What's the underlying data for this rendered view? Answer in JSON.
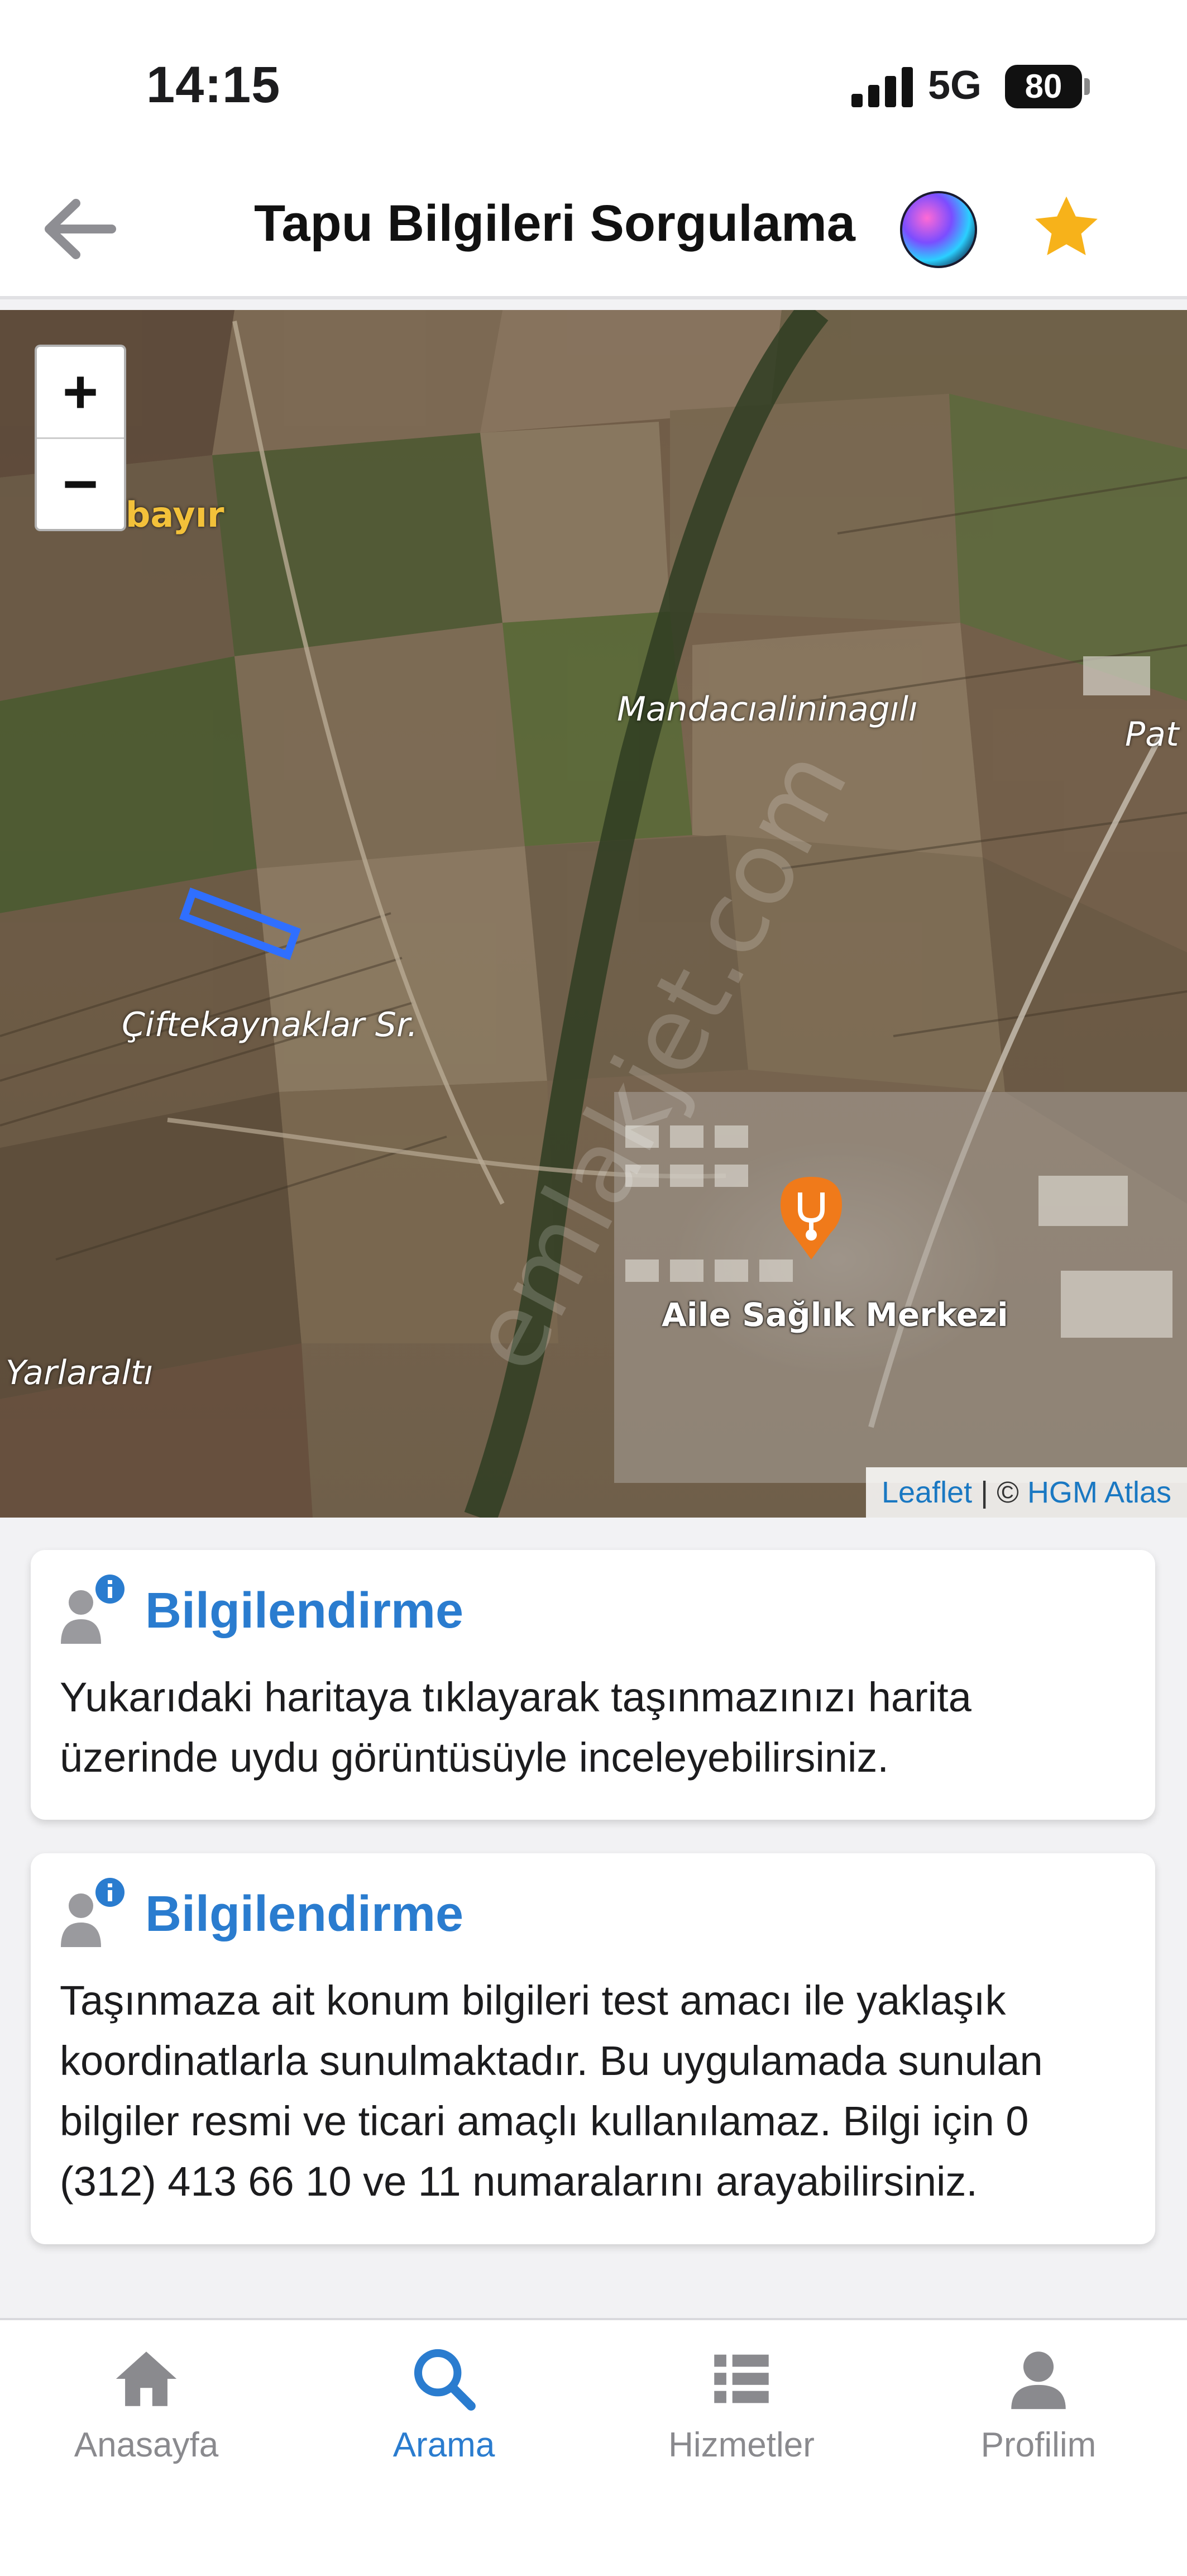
{
  "status_bar": {
    "time": "14:15",
    "network": "5G",
    "battery": "80"
  },
  "header": {
    "title": "Tapu Bilgileri Sorgulama"
  },
  "map": {
    "zoom_in": "+",
    "zoom_out": "−",
    "labels": {
      "bayir": "bayır",
      "mandaci": "Mandacıalininagılı",
      "pat": "Pat",
      "ciftekaynaklar": "Çiftekaynaklar Sr.",
      "yarlaralti": "Yarlaraltı",
      "health_center": "Aile Sağlık Merkezi"
    },
    "attribution": {
      "leaflet": "Leaflet",
      "separator": " | © ",
      "provider": "HGM Atlas"
    },
    "watermark": "emlakjet.com",
    "parcel_color": "#2f6fff"
  },
  "cards": [
    {
      "title": "Bilgilendirme",
      "text": "Yukarıdaki haritaya tıklayarak taşınmazınızı harita üzerinde uydu görüntüsüyle inceleyebilirsiniz."
    },
    {
      "title": "Bilgilendirme",
      "text": "Taşınmaza ait konum bilgileri test amacı ile yaklaşık koordinatlarla sunulmaktadır. Bu uygulamada sunulan bilgiler resmi ve ticari amaçlı kullanılamaz. Bilgi için 0 (312) 413 66 10 ve 11 numaralarını arayabilirsiniz."
    }
  ],
  "nav": {
    "items": [
      {
        "label": "Anasayfa",
        "icon": "home-icon"
      },
      {
        "label": "Arama",
        "icon": "search-icon",
        "active": true
      },
      {
        "label": "Hizmetler",
        "icon": "list-icon"
      },
      {
        "label": "Profilim",
        "icon": "user-icon"
      }
    ]
  },
  "colors": {
    "accent": "#2a7ccf",
    "star": "#f7b21a",
    "pin": "#f07a1a"
  }
}
